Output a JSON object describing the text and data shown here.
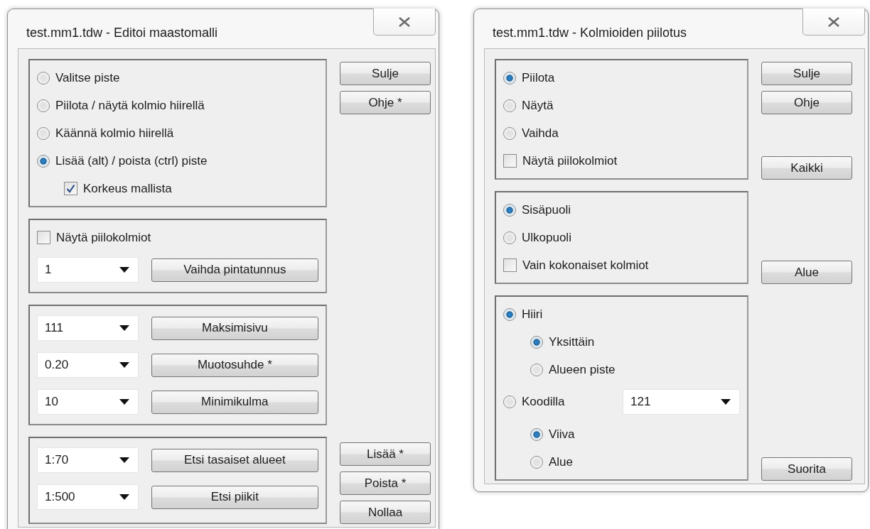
{
  "dialogs": [
    {
      "title": "test.mm1.tdw - Editoi maastomalli",
      "sections": [
        {
          "items": [
            {
              "kind": "radio",
              "label": "Valitse piste",
              "selected": false
            },
            {
              "kind": "radio",
              "label": "Piilota / näytä kolmio hiirellä",
              "selected": false
            },
            {
              "kind": "radio",
              "label": "Käännä kolmio hiirellä",
              "selected": false
            },
            {
              "kind": "radio",
              "label": "Lisää (alt) / poista (ctrl) piste",
              "selected": true,
              "children": [
                {
                  "kind": "checkbox",
                  "label": "Korkeus mallista",
                  "checked": true
                }
              ]
            }
          ],
          "top_buttons": [
            "Sulje",
            "Ohje *"
          ]
        },
        {
          "items": [
            {
              "kind": "checkbox",
              "label": "Näytä piilokolmiot",
              "checked": false
            },
            {
              "kind": "combo_button",
              "value": "1",
              "button": "Vaihda pintatunnus"
            }
          ]
        },
        {
          "items": [
            {
              "kind": "combo_button",
              "value": "111",
              "button": "Maksimisivu"
            },
            {
              "kind": "combo_button",
              "value": "0.20",
              "button": "Muotosuhde *"
            },
            {
              "kind": "combo_button",
              "value": "10",
              "button": "Minimikulma"
            }
          ]
        },
        {
          "items": [
            {
              "kind": "combo_button",
              "value": "1:70",
              "button": "Etsi tasaiset alueet"
            },
            {
              "kind": "combo_button",
              "value": "1:500",
              "button": "Etsi piikit"
            }
          ],
          "bottom_buttons": [
            "Lisää *",
            "Poista *",
            "Nollaa"
          ]
        }
      ]
    },
    {
      "title": "test.mm1.tdw - Kolmioiden piilotus",
      "sections": [
        {
          "items": [
            {
              "kind": "radio",
              "label": "Piilota",
              "selected": true
            },
            {
              "kind": "radio",
              "label": "Näytä",
              "selected": false
            },
            {
              "kind": "radio",
              "label": "Vaihda",
              "selected": false
            },
            {
              "kind": "checkbox",
              "label": "Näytä piilokolmiot",
              "checked": false
            }
          ],
          "top_buttons": [
            "Sulje",
            "Ohje"
          ],
          "bottom_buttons": [
            "Kaikki"
          ]
        },
        {
          "items": [
            {
              "kind": "radio",
              "label": "Sisäpuoli",
              "selected": true
            },
            {
              "kind": "radio",
              "label": "Ulkopuoli",
              "selected": false
            },
            {
              "kind": "checkbox",
              "label": "Vain kokonaiset kolmiot",
              "checked": false
            }
          ],
          "bottom_buttons": [
            "Alue"
          ]
        },
        {
          "items": [
            {
              "kind": "radio",
              "label": "Hiiri",
              "selected": true,
              "children": [
                {
                  "kind": "radio",
                  "label": "Yksittäin",
                  "selected": true
                },
                {
                  "kind": "radio",
                  "label": "Alueen piste",
                  "selected": false
                }
              ]
            },
            {
              "kind": "radio",
              "label": "Koodilla",
              "selected": false,
              "combo": "121",
              "children": [
                {
                  "kind": "radio",
                  "label": "Viiva",
                  "selected": true
                },
                {
                  "kind": "radio",
                  "label": "Alue",
                  "selected": false
                }
              ]
            }
          ],
          "bottom_buttons": [
            "Suorita"
          ]
        }
      ]
    }
  ]
}
